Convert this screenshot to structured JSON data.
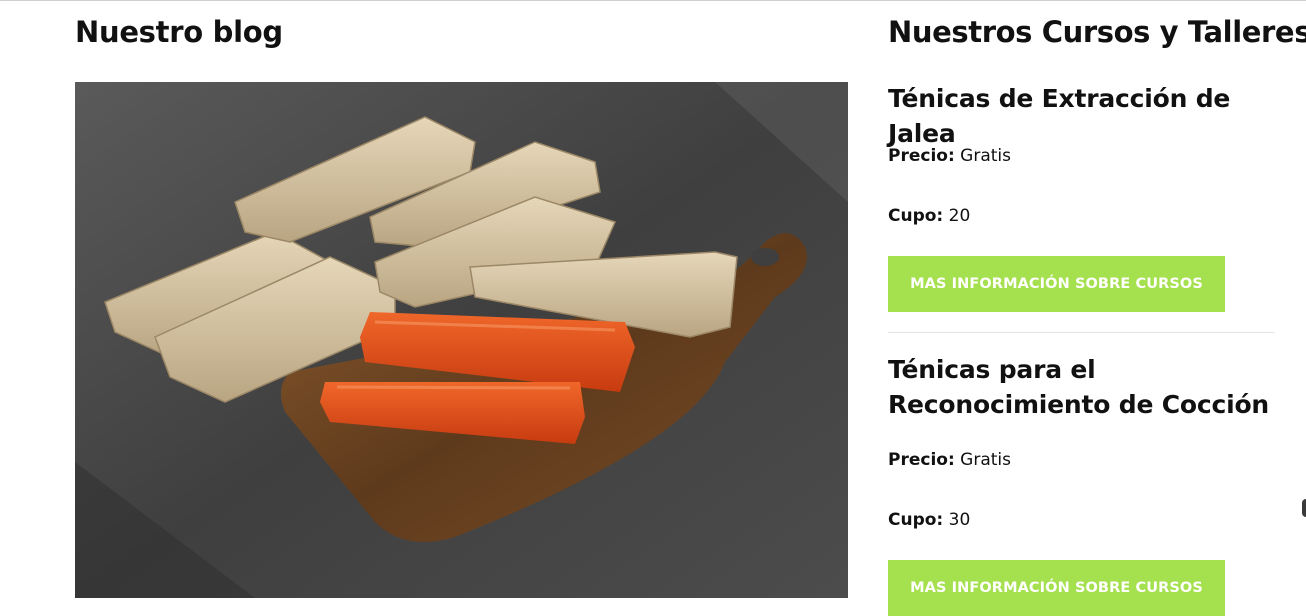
{
  "blog": {
    "title": "Nuestro blog",
    "image_alt": "Guava paste bars and leaf-wrapped bocadillos on a rustic wooden board"
  },
  "courses": {
    "title": "Nuestros Cursos y Talleres",
    "items": [
      {
        "name": "Ténicas de Extracción de Jalea",
        "price_label": "Precio:",
        "price_value": "Gratis",
        "capacity_label": "Cupo:",
        "capacity_value": "20",
        "button_label": "MAS INFORMACIÓN SOBRE CURSOS"
      },
      {
        "name": "Ténicas para el Reconocimiento de Cocción",
        "price_label": "Precio:",
        "price_value": "Gratis",
        "capacity_label": "Cupo:",
        "capacity_value": "30",
        "button_label": "MAS INFORMACIÓN SOBRE CURSOS"
      }
    ]
  },
  "colors": {
    "button_bg": "#a5e04f",
    "button_text": "#ffffff",
    "text": "#111111"
  }
}
